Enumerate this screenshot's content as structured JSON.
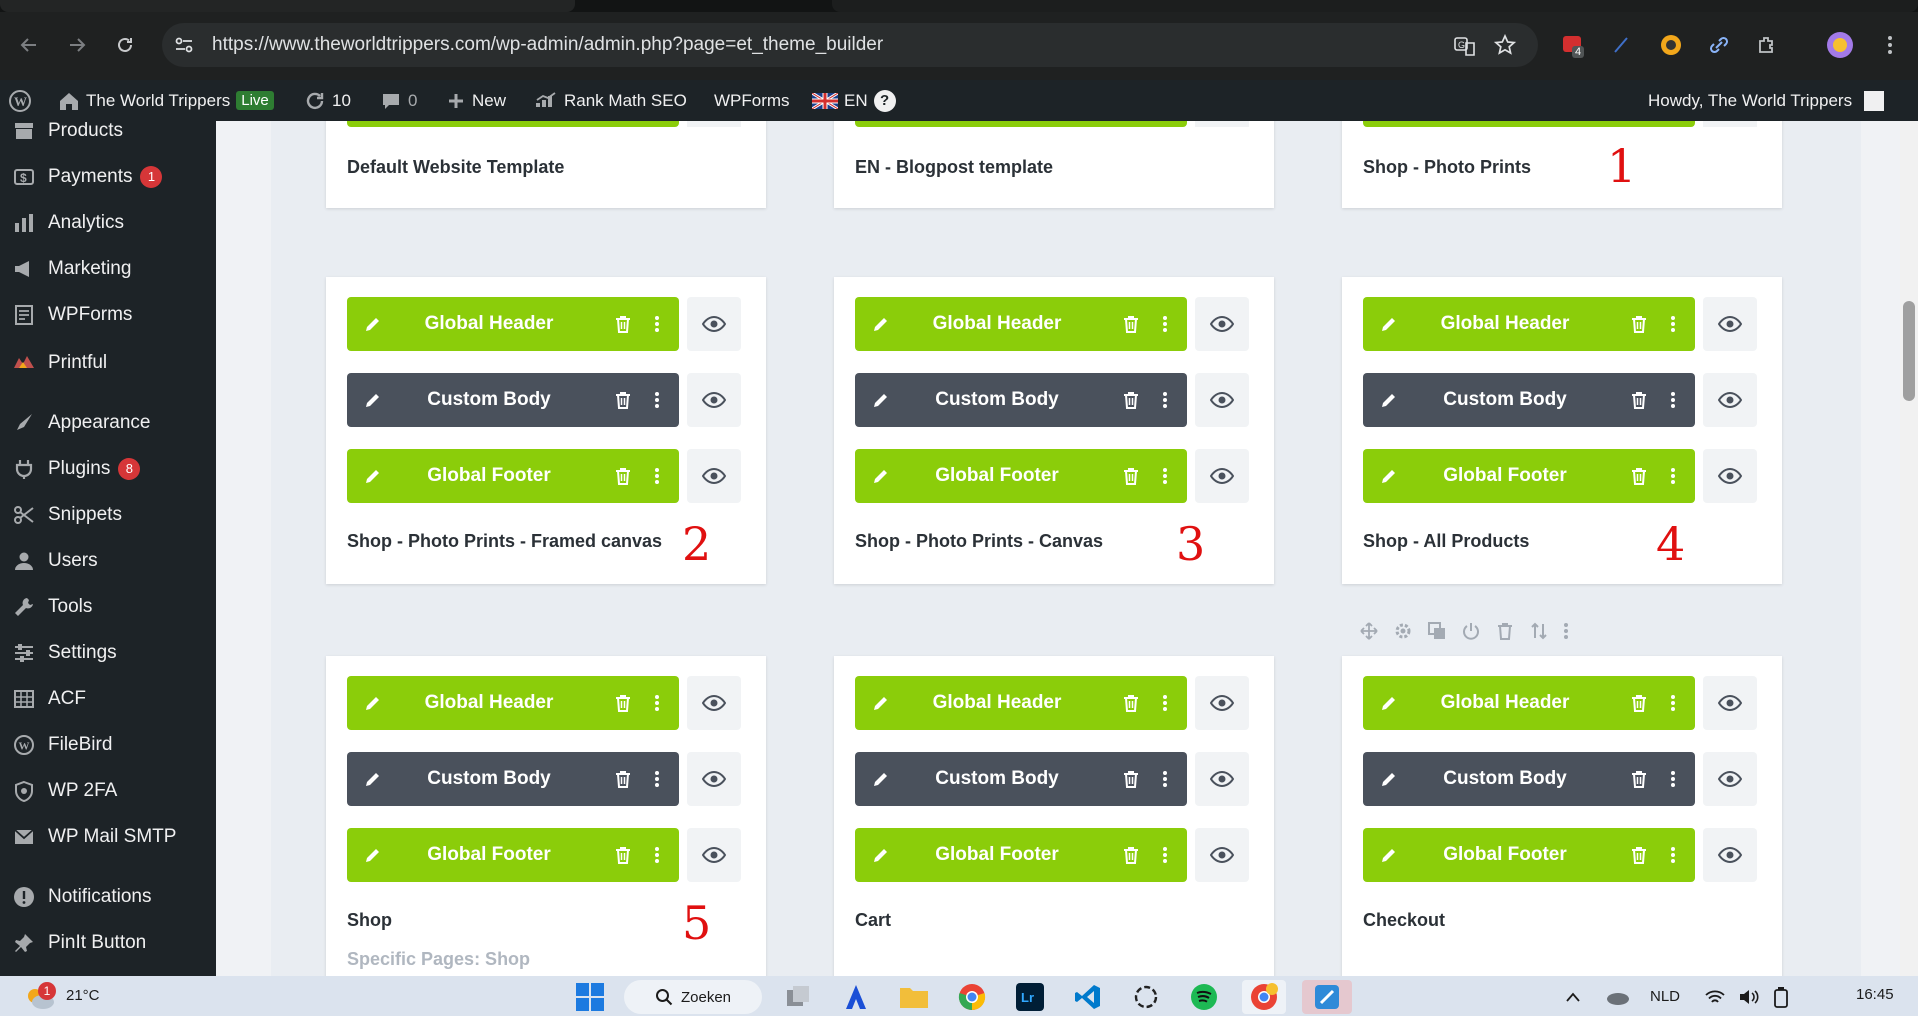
{
  "browser": {
    "url": "https://www.theworldtrippers.com/wp-admin/admin.php?page=et_theme_builder",
    "extension_badge": "4"
  },
  "adminbar": {
    "site_name": "The World Trippers",
    "live_label": "Live",
    "updates_count": "10",
    "comments_count": "0",
    "new_label": "New",
    "rankmath_label": "Rank Math SEO",
    "wpforms_label": "WPForms",
    "lang_label": "EN",
    "help_label": "?",
    "howdy": "Howdy, The World Trippers"
  },
  "sidebar": {
    "items": [
      {
        "label": "Products",
        "icon": "archive-icon"
      },
      {
        "label": "Payments",
        "icon": "dollar-icon",
        "count": "1"
      },
      {
        "label": "Analytics",
        "icon": "bar-chart-icon"
      },
      {
        "label": "Marketing",
        "icon": "megaphone-icon"
      },
      {
        "label": "WPForms",
        "icon": "form-icon"
      },
      {
        "label": "Printful",
        "icon": "printful-icon"
      },
      {
        "label": "Appearance",
        "icon": "brush-icon"
      },
      {
        "label": "Plugins",
        "icon": "plug-icon",
        "count": "8"
      },
      {
        "label": "Snippets",
        "icon": "scissors-icon"
      },
      {
        "label": "Users",
        "icon": "user-icon"
      },
      {
        "label": "Tools",
        "icon": "wrench-icon"
      },
      {
        "label": "Settings",
        "icon": "sliders-icon"
      },
      {
        "label": "ACF",
        "icon": "grid-icon"
      },
      {
        "label": "FileBird",
        "icon": "wordpress-icon"
      },
      {
        "label": "WP 2FA",
        "icon": "shield-icon"
      },
      {
        "label": "WP Mail SMTP",
        "icon": "mail-icon"
      },
      {
        "label": "Notifications",
        "icon": "alert-icon"
      },
      {
        "label": "PinIt Button",
        "icon": "pin-icon"
      }
    ]
  },
  "templates": {
    "header_label": "Global Header",
    "body_label": "Custom Body",
    "footer_label": "Global Footer",
    "top_row": [
      {
        "title": "Default Website Template"
      },
      {
        "title": "EN - Blogpost template"
      },
      {
        "title": "Shop - Photo Prints",
        "annotation": "1"
      }
    ],
    "cards": [
      {
        "title": "Shop - Photo Prints - Framed canvas",
        "annotation": "2"
      },
      {
        "title": "Shop - Photo Prints - Canvas",
        "annotation": "3"
      },
      {
        "title": "Shop - All Products",
        "annotation": "4"
      },
      {
        "title": "Shop",
        "annotation": "5",
        "subtitle": "Specific Pages: Shop"
      },
      {
        "title": "Cart"
      },
      {
        "title": "Checkout"
      }
    ]
  },
  "taskbar": {
    "temperature": "21°C",
    "weather_badge": "1",
    "search_label": "Zoeken",
    "language": "NLD",
    "time": "16:45"
  },
  "colors": {
    "green": "#8bcd0a",
    "dark": "#4a515c",
    "annotation": "#e01010"
  }
}
